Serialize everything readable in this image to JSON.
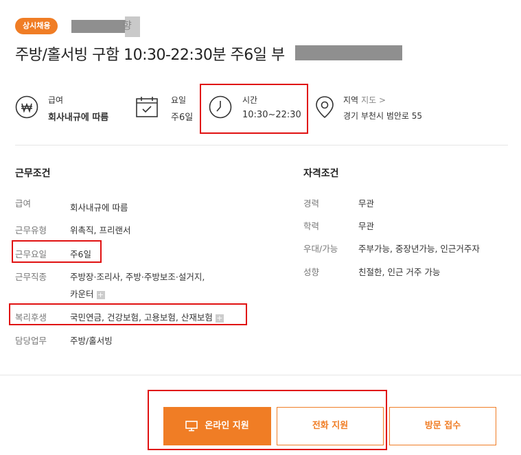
{
  "header": {
    "badge": "상시채용",
    "company_visible": "향",
    "title": "주방/홀서빙 구함 10:30-22:30분 주6일 부"
  },
  "summary": [
    {
      "icon": "won-icon",
      "label": "급여",
      "value": "회사내규에 따름"
    },
    {
      "icon": "calendar-icon",
      "label": "요일",
      "value": "주6일"
    },
    {
      "icon": "clock-icon",
      "label": "시간",
      "value": "10:30~22:30"
    },
    {
      "icon": "location-icon",
      "label": "지역",
      "link": "지도 >",
      "value": "경기 부천시 범안로 55"
    }
  ],
  "work": {
    "title": "근무조건",
    "rows": [
      {
        "label": "급여",
        "value": "회사내규에 따름"
      },
      {
        "label": "근무유형",
        "value": "위촉직, 프리랜서"
      },
      {
        "label": "근무요일",
        "value": "주6일"
      },
      {
        "label": "근무직종",
        "value": "주방장·조리사, 주방·주방보조·설거지,",
        "value2": "카운터"
      },
      {
        "label": "복리후생",
        "value": "국민연금, 건강보험, 고용보험, 산재보험"
      },
      {
        "label": "담당업무",
        "value": "주방/홀서빙"
      }
    ]
  },
  "qual": {
    "title": "자격조건",
    "rows": [
      {
        "label": "경력",
        "value": "무관"
      },
      {
        "label": "학력",
        "value": "무관"
      },
      {
        "label": "우대/가능",
        "value": "주부가능, 중장년가능, 인근거주자"
      },
      {
        "label": "성향",
        "value": "친절한, 인근 거주 가능"
      }
    ]
  },
  "buttons": {
    "online": "온라인 지원",
    "phone": "전화 지원",
    "visit": "방문 접수"
  },
  "colors": {
    "accent": "#f07d25",
    "highlight": "#e01010"
  }
}
